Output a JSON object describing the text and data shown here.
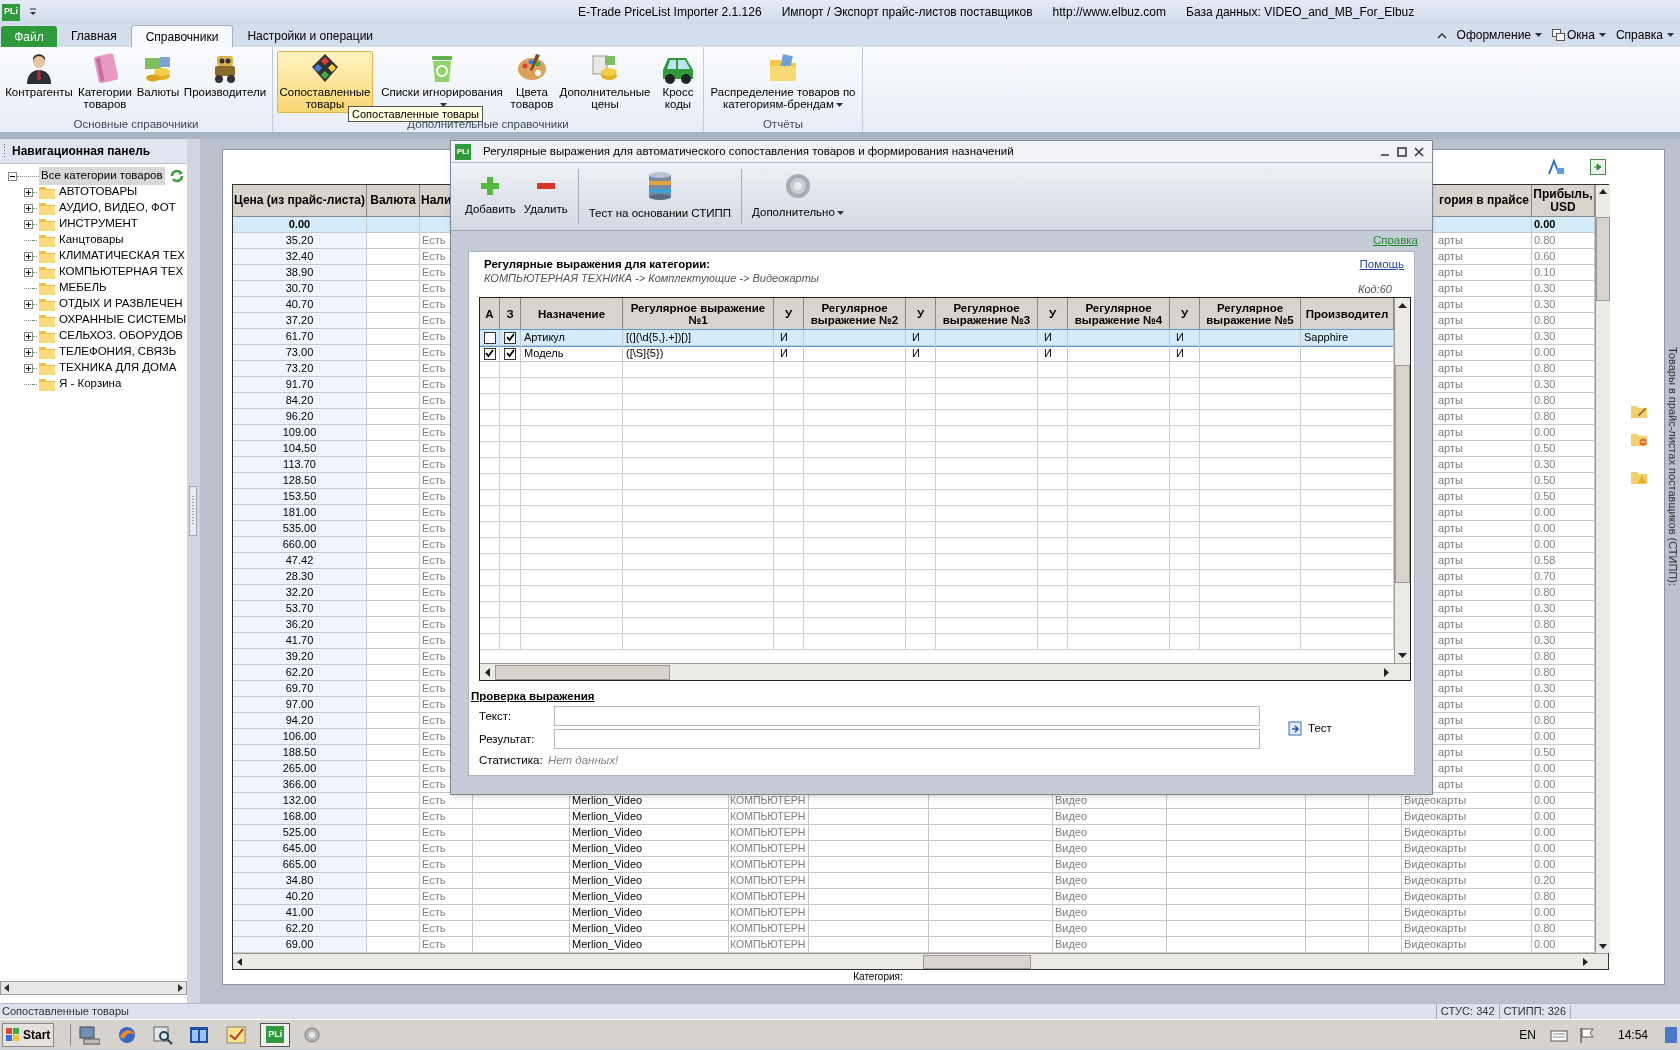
{
  "title_bar": {
    "app_icon": "PLi",
    "texts": [
      "E-Trade PriceList Importer 2.1.126",
      "Импорт / Экспорт прайс-листов поставщиков",
      "http://www.elbuz.com",
      "База данных: VIDEO_and_MB_For_Elbuz"
    ]
  },
  "ribbon": {
    "file_tab": "Файл",
    "tabs": [
      {
        "label": "Главная",
        "selected": false
      },
      {
        "label": "Справочники",
        "selected": true
      },
      {
        "label": "Настройки и операции",
        "selected": false
      }
    ],
    "right_menus": [
      "Оформление",
      "Окна",
      "Справка"
    ],
    "groups": [
      {
        "title": "Основные справочники",
        "items": [
          {
            "label": "Контрагенты",
            "has_menu": false,
            "highlighted": false
          },
          {
            "label": "Категории товаров",
            "has_menu": false,
            "highlighted": false
          },
          {
            "label": "Валюты",
            "has_menu": false,
            "highlighted": false
          },
          {
            "label": "Производители",
            "has_menu": false,
            "highlighted": false
          }
        ]
      },
      {
        "title": "Дополнительные справочники",
        "items": [
          {
            "label": "Сопоставленные товары",
            "has_menu": false,
            "highlighted": true
          },
          {
            "label": "Списки игнорирования",
            "has_menu": true,
            "highlighted": false
          },
          {
            "label": "Цвета товаров",
            "has_menu": false,
            "highlighted": false
          },
          {
            "label": "Дополнительные цены",
            "has_menu": false,
            "highlighted": false
          },
          {
            "label": "Кросс коды",
            "has_menu": false,
            "highlighted": false
          }
        ]
      },
      {
        "title": "Отчёты",
        "items": [
          {
            "label": "Распределение товаров по категориям-брендам",
            "has_menu": true,
            "highlighted": false
          }
        ]
      }
    ],
    "tooltip": "Сопоставленные товары"
  },
  "nav_panel": {
    "title": "Навигационная панель",
    "tree": [
      {
        "label": "Все категории товаров",
        "expanded": true,
        "selected": true,
        "children": [
          {
            "label": "АВТОТОВАРЫ",
            "expandable": true
          },
          {
            "label": "АУДИО, ВИДЕО, ФОТ",
            "expandable": true
          },
          {
            "label": "ИНСТРУМЕНТ",
            "expandable": true
          },
          {
            "label": "Канцтовары",
            "expandable": false
          },
          {
            "label": "КЛИМАТИЧЕСКАЯ ТЕХ",
            "expandable": true
          },
          {
            "label": "КОМПЬЮТЕРНАЯ ТЕХ",
            "expandable": true
          },
          {
            "label": "МЕБЕЛЬ",
            "expandable": false
          },
          {
            "label": "ОТДЫХ И РАЗВЛЕЧЕН",
            "expandable": true
          },
          {
            "label": "ОХРАННЫЕ СИСТЕМЫ",
            "expandable": false
          },
          {
            "label": "СЕЛЬХОЗ. ОБОРУДОВ",
            "expandable": true
          },
          {
            "label": "ТЕЛЕФОНИЯ, СВЯЗЬ",
            "expandable": true
          },
          {
            "label": "ТЕХНИКА ДЛЯ ДОМА",
            "expandable": true
          },
          {
            "label": "Я - Корзина",
            "expandable": false
          }
        ]
      }
    ]
  },
  "grid": {
    "headers": {
      "price": "Цена (из прайс-листа)",
      "currency": "Валюта",
      "availability": "Нали",
      "category_in_price": "гория в прайсе",
      "profit": "Прибыль, USD"
    },
    "rows": [
      {
        "selected": true,
        "price": "0.00",
        "profit": "0.00"
      },
      {
        "selected": false,
        "price": "35.20",
        "availability": "Есть",
        "category_in_price": "арты",
        "profit": "0.80"
      },
      {
        "selected": false,
        "price": "32.40",
        "availability": "Есть",
        "category_in_price": "арты",
        "profit": "0.60"
      },
      {
        "selected": false,
        "price": "38.90",
        "availability": "Есть",
        "category_in_price": "арты",
        "profit": "0.10"
      },
      {
        "selected": false,
        "price": "30.70",
        "availability": "Есть",
        "category_in_price": "арты",
        "profit": "0.30"
      },
      {
        "selected": false,
        "price": "40.70",
        "availability": "Есть",
        "category_in_price": "арты",
        "profit": "0.30"
      },
      {
        "selected": false,
        "price": "37.20",
        "availability": "Есть",
        "category_in_price": "арты",
        "profit": "0.80"
      },
      {
        "selected": false,
        "price": "61.70",
        "availability": "Есть",
        "category_in_price": "арты",
        "profit": "0.30"
      },
      {
        "selected": false,
        "price": "73.00",
        "availability": "Есть",
        "category_in_price": "арты",
        "profit": "0.00"
      },
      {
        "selected": false,
        "price": "73.20",
        "availability": "Есть",
        "category_in_price": "арты",
        "profit": "0.80"
      },
      {
        "selected": false,
        "price": "91.70",
        "availability": "Есть",
        "category_in_price": "арты",
        "profit": "0.30"
      },
      {
        "selected": false,
        "price": "84.20",
        "availability": "Есть",
        "category_in_price": "арты",
        "profit": "0.80"
      },
      {
        "selected": false,
        "price": "96.20",
        "availability": "Есть",
        "category_in_price": "арты",
        "profit": "0.80"
      },
      {
        "selected": false,
        "price": "109.00",
        "availability": "Есть",
        "category_in_price": "арты",
        "profit": "0.00"
      },
      {
        "selected": false,
        "price": "104.50",
        "availability": "Есть",
        "category_in_price": "арты",
        "profit": "0.50"
      },
      {
        "selected": false,
        "price": "113.70",
        "availability": "Есть",
        "category_in_price": "арты",
        "profit": "0.30"
      },
      {
        "selected": false,
        "price": "128.50",
        "availability": "Есть",
        "category_in_price": "арты",
        "profit": "0.50"
      },
      {
        "selected": false,
        "price": "153.50",
        "availability": "Есть",
        "category_in_price": "арты",
        "profit": "0.50"
      },
      {
        "selected": false,
        "price": "181.00",
        "availability": "Есть",
        "category_in_price": "арты",
        "profit": "0.00"
      },
      {
        "selected": false,
        "price": "535.00",
        "availability": "Есть",
        "category_in_price": "арты",
        "profit": "0.00"
      },
      {
        "selected": false,
        "price": "660.00",
        "availability": "Есть",
        "category_in_price": "арты",
        "profit": "0.00"
      },
      {
        "selected": false,
        "price": "47.42",
        "availability": "Есть",
        "category_in_price": "арты",
        "profit": "0.58"
      },
      {
        "selected": false,
        "price": "28.30",
        "availability": "Есть",
        "category_in_price": "арты",
        "profit": "0.70"
      },
      {
        "selected": false,
        "price": "32.20",
        "availability": "Есть",
        "category_in_price": "арты",
        "profit": "0.80"
      },
      {
        "selected": false,
        "price": "53.70",
        "availability": "Есть",
        "category_in_price": "арты",
        "profit": "0.30"
      },
      {
        "selected": false,
        "price": "36.20",
        "availability": "Есть",
        "category_in_price": "арты",
        "profit": "0.80"
      },
      {
        "selected": false,
        "price": "41.70",
        "availability": "Есть",
        "category_in_price": "арты",
        "profit": "0.30"
      },
      {
        "selected": false,
        "price": "39.20",
        "availability": "Есть",
        "category_in_price": "арты",
        "profit": "0.80"
      },
      {
        "selected": false,
        "price": "62.20",
        "availability": "Есть",
        "category_in_price": "арты",
        "profit": "0.80"
      },
      {
        "selected": false,
        "price": "69.70",
        "availability": "Есть",
        "category_in_price": "арты",
        "profit": "0.30"
      },
      {
        "selected": false,
        "price": "97.00",
        "availability": "Есть",
        "category_in_price": "арты",
        "profit": "0.00"
      },
      {
        "selected": false,
        "price": "94.20",
        "availability": "Есть",
        "category_in_price": "арты",
        "profit": "0.80"
      },
      {
        "selected": false,
        "price": "106.00",
        "availability": "Есть",
        "category_in_price": "арты",
        "profit": "0.00"
      },
      {
        "selected": false,
        "price": "188.50",
        "availability": "Есть",
        "category_in_price": "арты",
        "profit": "0.50"
      },
      {
        "selected": false,
        "price": "265.00",
        "availability": "Есть",
        "category_in_price": "арты",
        "profit": "0.00"
      },
      {
        "selected": false,
        "price": "366.00",
        "availability": "Есть",
        "category_in_price": "арты",
        "profit": "0.00"
      },
      {
        "selected": false,
        "price": "132.00",
        "availability": "Есть",
        "supplier": "Merlion_Video",
        "category": "КОМПЬЮТЕРН",
        "type": "Видео",
        "category_in_price": "Видеокарты",
        "profit": "0.00"
      },
      {
        "selected": false,
        "price": "168.00",
        "availability": "Есть",
        "supplier": "Merlion_Video",
        "category": "КОМПЬЮТЕРН",
        "type": "Видео",
        "category_in_price": "Видеокарты",
        "profit": "0.00"
      },
      {
        "selected": false,
        "price": "525.00",
        "availability": "Есть",
        "supplier": "Merlion_Video",
        "category": "КОМПЬЮТЕРН",
        "type": "Видео",
        "category_in_price": "Видеокарты",
        "profit": "0.00"
      },
      {
        "selected": false,
        "price": "645.00",
        "availability": "Есть",
        "supplier": "Merlion_Video",
        "category": "КОМПЬЮТЕРН",
        "type": "Видео",
        "category_in_price": "Видеокарты",
        "profit": "0.00"
      },
      {
        "selected": false,
        "price": "665.00",
        "availability": "Есть",
        "supplier": "Merlion_Video",
        "category": "КОМПЬЮТЕРН",
        "type": "Видео",
        "category_in_price": "Видеокарты",
        "profit": "0.00"
      },
      {
        "selected": false,
        "price": "34.80",
        "availability": "Есть",
        "supplier": "Merlion_Video",
        "category": "КОМПЬЮТЕРН",
        "type": "Видео",
        "category_in_price": "Видеокарты",
        "profit": "0.20"
      },
      {
        "selected": false,
        "price": "40.20",
        "availability": "Есть",
        "supplier": "Merlion_Video",
        "category": "КОМПЬЮТЕРН",
        "type": "Видео",
        "category_in_price": "Видеокарты",
        "profit": "0.80"
      },
      {
        "selected": false,
        "price": "41.00",
        "availability": "Есть",
        "supplier": "Merlion_Video",
        "category": "КОМПЬЮТЕРН",
        "type": "Видео",
        "category_in_price": "Видеокарты",
        "profit": "0.00"
      },
      {
        "selected": false,
        "price": "62.20",
        "availability": "Есть",
        "supplier": "Merlion_Video",
        "category": "КОМПЬЮТЕРН",
        "type": "Видео",
        "category_in_price": "Видеокарты",
        "profit": "0.80"
      },
      {
        "selected": false,
        "price": "69.00",
        "availability": "Есть",
        "supplier": "Merlion_Video",
        "category": "КОМПЬЮТЕРН",
        "type": "Видео",
        "category_in_price": "Видеокарты",
        "profit": "0.00"
      }
    ],
    "footer_label": "Категория:"
  },
  "side_panel": {
    "title": "Товары в прайс-листах поставщиков (СТИПП):"
  },
  "dialog": {
    "app_icon": "PLi",
    "title": "Регулярные выражения для автоматического сопоставления товаров и формирования назначений",
    "toolbar": [
      {
        "label": "Добавить",
        "has_menu": false
      },
      {
        "label": "Удалить",
        "has_menu": false
      },
      {
        "label": "Тест на основании СТИПП",
        "has_menu": false
      },
      {
        "label": "Дополнительно",
        "has_menu": true
      }
    ],
    "help_link": "Справка",
    "heading": "Регулярные выражения для категории:",
    "path": "КОМПЬЮТЕРНАЯ ТЕХНИКА -> Комплектующие -> Видеокарты",
    "help_link_2": "Помощь",
    "code": "Код:60",
    "columns": [
      "А",
      "З",
      "Назначение",
      "Регулярное выражение №1",
      "У",
      "Регулярное выражение №2",
      "У",
      "Регулярное выражение №3",
      "У",
      "Регулярное выражение №4",
      "У",
      "Регулярное выражение №5",
      "Производител"
    ],
    "rows": [
      {
        "selected": true,
        "a_checked": false,
        "z_checked": true,
        "purpose": "Артикул",
        "regex_1": "[(](\\d{5,}.+])[)]",
        "op_1": "И",
        "op_2": "И",
        "op_3": "И",
        "op_4": "И",
        "manufacturer": "Sapphire"
      },
      {
        "selected": false,
        "a_checked": true,
        "z_checked": true,
        "purpose": "Модель",
        "regex_1": "([\\S]{5})",
        "op_1": "И",
        "op_2": "И",
        "op_3": "И",
        "op_4": "И"
      }
    ],
    "check": {
      "title": "Проверка выражения",
      "fields": [
        {
          "label": "Текст:"
        },
        {
          "label": "Результат:"
        }
      ],
      "stats_label": "Статистика:",
      "stats_value": "Нет данных!",
      "test_button": "Тест"
    }
  },
  "status_bar": {
    "text": "Сопоставленные товары",
    "counters": [
      "СТУС: 342",
      "СТИПП: 326"
    ]
  },
  "taskbar": {
    "start": "Start",
    "app_label": "PLi",
    "language": "EN",
    "time": "14:54"
  }
}
